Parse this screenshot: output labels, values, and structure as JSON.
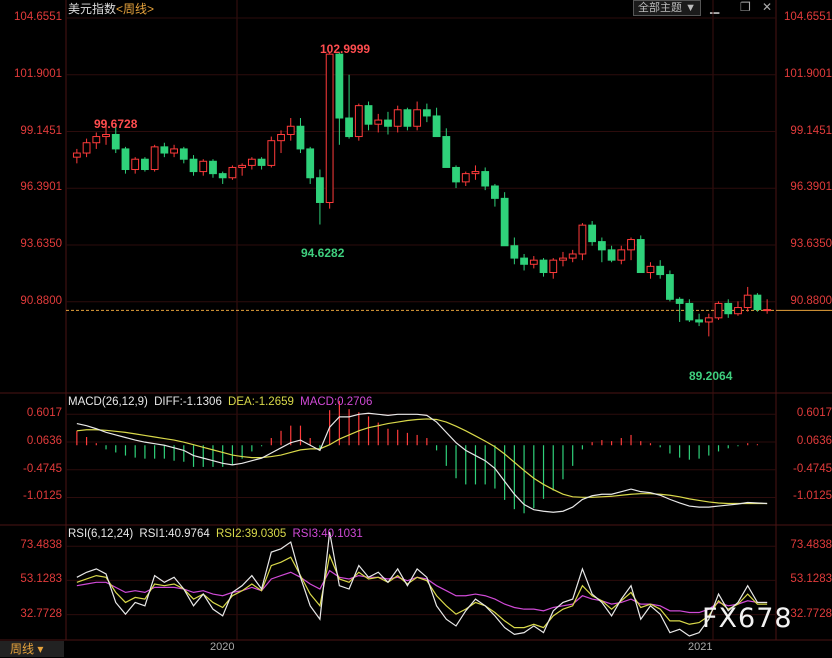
{
  "header": {
    "title": "美元指数",
    "period_label": "<周线>",
    "theme_button": "全部主题",
    "icons": [
      "down-arrow-icon",
      "maximize-icon",
      "restore-icon",
      "close-icon"
    ]
  },
  "colors": {
    "up": "#ff3b3b",
    "down": "#2fd17a",
    "diff": "#e8e8e8",
    "dea": "#d9d94a",
    "macd": "#d04ad6",
    "grid": "#3a1010",
    "last": "#e7a33c"
  },
  "main_axis_ticks": [
    "104.6551",
    "101.9001",
    "99.1451",
    "96.3901",
    "93.6350",
    "90.8800"
  ],
  "main_axis_values": [
    104.6551,
    101.9001,
    99.1451,
    96.3901,
    93.635,
    90.88
  ],
  "annotations": {
    "high": "102.9999",
    "prev_high": "99.6728",
    "low1": "94.6282",
    "low2": "89.2064"
  },
  "macd": {
    "label": "MACD(26,12,9)",
    "diff_label": "DIFF:-1.1306",
    "dea_label": "DEA:-1.2659",
    "macd_label": "MACD:0.2706",
    "ticks": [
      "0.6017",
      "0.0636",
      "-0.4745",
      "-1.0125"
    ],
    "tick_values": [
      0.6017,
      0.0636,
      -0.4745,
      -1.0125
    ]
  },
  "rsi": {
    "label": "RSI(6,12,24)",
    "rsi1_label": "RSI1:40.9764",
    "rsi2_label": "RSI2:39.0305",
    "rsi3_label": "RSI3:40.1031",
    "ticks": [
      "73.4838",
      "53.1283",
      "32.7728"
    ],
    "tick_values": [
      73.4838,
      53.1283,
      32.7728
    ]
  },
  "x_labels": [
    "2020",
    "2021"
  ],
  "footer": {
    "period_button": "周线",
    "watermark": "FX678"
  },
  "chart_data": {
    "type": "candlestick",
    "title": "美元指数 <周线>",
    "ylim": [
      86.5,
      104.6551
    ],
    "last_close": 90.46,
    "candles": [
      [
        97.9,
        98.3,
        97.6,
        98.1
      ],
      [
        98.1,
        98.8,
        97.9,
        98.6
      ],
      [
        98.6,
        99.1,
        98.3,
        98.9
      ],
      [
        98.9,
        99.67,
        98.5,
        99.0
      ],
      [
        99.0,
        99.4,
        98.1,
        98.3
      ],
      [
        98.3,
        98.4,
        97.1,
        97.3
      ],
      [
        97.3,
        97.9,
        97.1,
        97.8
      ],
      [
        97.8,
        97.9,
        97.2,
        97.3
      ],
      [
        97.3,
        98.5,
        97.2,
        98.4
      ],
      [
        98.4,
        98.6,
        97.9,
        98.1
      ],
      [
        98.1,
        98.5,
        97.9,
        98.3
      ],
      [
        98.3,
        98.4,
        97.6,
        97.8
      ],
      [
        97.8,
        98.0,
        97.0,
        97.2
      ],
      [
        97.2,
        97.8,
        97.0,
        97.7
      ],
      [
        97.7,
        97.8,
        96.9,
        97.1
      ],
      [
        97.1,
        97.2,
        96.6,
        96.9
      ],
      [
        96.9,
        97.5,
        96.8,
        97.4
      ],
      [
        97.4,
        97.6,
        97.0,
        97.5
      ],
      [
        97.5,
        97.9,
        97.3,
        97.8
      ],
      [
        97.8,
        97.9,
        97.3,
        97.5
      ],
      [
        97.5,
        98.9,
        97.4,
        98.7
      ],
      [
        98.7,
        99.2,
        98.1,
        99.0
      ],
      [
        99.0,
        99.8,
        98.7,
        99.4
      ],
      [
        99.4,
        99.8,
        98.1,
        98.3
      ],
      [
        98.3,
        98.4,
        96.6,
        96.9
      ],
      [
        96.9,
        97.3,
        94.63,
        95.7
      ],
      [
        95.7,
        102.99,
        95.4,
        102.9
      ],
      [
        102.9,
        102.99,
        98.5,
        99.8
      ],
      [
        99.8,
        101.9,
        98.8,
        98.9
      ],
      [
        98.9,
        100.5,
        98.7,
        100.4
      ],
      [
        100.4,
        100.6,
        99.2,
        99.5
      ],
      [
        99.5,
        100.0,
        99.1,
        99.7
      ],
      [
        99.7,
        100.1,
        99.0,
        99.4
      ],
      [
        99.4,
        100.4,
        99.1,
        100.2
      ],
      [
        100.2,
        100.3,
        99.2,
        99.4
      ],
      [
        99.4,
        100.6,
        99.2,
        100.2
      ],
      [
        100.2,
        100.5,
        99.6,
        99.9
      ],
      [
        99.9,
        100.3,
        98.9,
        98.9
      ],
      [
        98.9,
        99.3,
        97.4,
        97.4
      ],
      [
        97.4,
        97.5,
        96.4,
        96.7
      ],
      [
        96.7,
        97.2,
        96.5,
        97.1
      ],
      [
        97.1,
        97.5,
        96.8,
        97.2
      ],
      [
        97.2,
        97.4,
        96.3,
        96.5
      ],
      [
        96.5,
        96.6,
        95.5,
        95.9
      ],
      [
        95.9,
        96.2,
        93.6,
        93.6
      ],
      [
        93.6,
        94.0,
        92.7,
        93.0
      ],
      [
        93.0,
        93.2,
        92.4,
        92.7
      ],
      [
        92.7,
        93.1,
        92.5,
        92.9
      ],
      [
        92.9,
        93.0,
        92.1,
        92.3
      ],
      [
        92.3,
        93.0,
        92.0,
        92.9
      ],
      [
        92.9,
        93.3,
        92.6,
        93.0
      ],
      [
        93.0,
        93.4,
        92.8,
        93.2
      ],
      [
        93.2,
        94.7,
        92.9,
        94.6
      ],
      [
        94.6,
        94.8,
        93.6,
        93.8
      ],
      [
        93.8,
        94.0,
        92.8,
        93.4
      ],
      [
        93.4,
        93.6,
        92.8,
        92.9
      ],
      [
        92.9,
        93.6,
        92.7,
        93.4
      ],
      [
        93.4,
        94.0,
        92.9,
        93.9
      ],
      [
        93.9,
        94.1,
        92.3,
        92.3
      ],
      [
        92.3,
        92.8,
        92.0,
        92.6
      ],
      [
        92.6,
        92.9,
        92.0,
        92.2
      ],
      [
        92.2,
        92.4,
        90.9,
        91.0
      ],
      [
        91.0,
        91.1,
        89.9,
        90.8
      ],
      [
        90.8,
        91.0,
        89.9,
        90.0
      ],
      [
        90.0,
        90.3,
        89.7,
        89.9
      ],
      [
        89.9,
        90.3,
        89.2,
        90.1
      ],
      [
        90.1,
        90.9,
        90.0,
        90.8
      ],
      [
        90.8,
        91.0,
        90.1,
        90.3
      ],
      [
        90.3,
        90.9,
        90.2,
        90.6
      ],
      [
        90.6,
        91.6,
        90.4,
        91.2
      ],
      [
        91.2,
        91.3,
        90.4,
        90.5
      ],
      [
        90.5,
        91.0,
        90.3,
        90.5
      ]
    ],
    "macd_ylim": [
      -1.45,
      0.8
    ],
    "diff": [
      0.42,
      0.38,
      0.32,
      0.25,
      0.2,
      0.15,
      0.1,
      0.06,
      0.03,
      0.0,
      -0.05,
      -0.1,
      -0.2,
      -0.25,
      -0.3,
      -0.35,
      -0.38,
      -0.35,
      -0.3,
      -0.25,
      -0.15,
      -0.05,
      0.05,
      0.1,
      0.0,
      -0.1,
      0.35,
      0.55,
      0.55,
      0.6,
      0.62,
      0.6,
      0.58,
      0.6,
      0.6,
      0.6,
      0.58,
      0.45,
      0.25,
      0.05,
      -0.1,
      -0.2,
      -0.3,
      -0.45,
      -0.7,
      -0.95,
      -1.15,
      -1.25,
      -1.28,
      -1.3,
      -1.28,
      -1.2,
      -1.05,
      -0.98,
      -0.95,
      -0.95,
      -0.9,
      -0.85,
      -0.9,
      -0.92,
      -0.97,
      -1.05,
      -1.12,
      -1.18,
      -1.2,
      -1.2,
      -1.18,
      -1.16,
      -1.14,
      -1.11,
      -1.12,
      -1.13
    ],
    "dea": [
      0.28,
      0.3,
      0.3,
      0.29,
      0.27,
      0.25,
      0.22,
      0.19,
      0.16,
      0.13,
      0.1,
      0.06,
      0.01,
      -0.04,
      -0.09,
      -0.14,
      -0.19,
      -0.22,
      -0.24,
      -0.24,
      -0.22,
      -0.19,
      -0.14,
      -0.09,
      -0.07,
      -0.07,
      0.01,
      0.12,
      0.2,
      0.28,
      0.34,
      0.38,
      0.42,
      0.45,
      0.48,
      0.5,
      0.51,
      0.5,
      0.45,
      0.37,
      0.28,
      0.18,
      0.08,
      -0.03,
      -0.17,
      -0.33,
      -0.49,
      -0.64,
      -0.76,
      -0.86,
      -0.95,
      -1.0,
      -1.01,
      -1.01,
      -1.0,
      -0.99,
      -0.97,
      -0.95,
      -0.94,
      -0.94,
      -0.95,
      -0.97,
      -1.0,
      -1.04,
      -1.07,
      -1.1,
      -1.12,
      -1.13,
      -1.13,
      -1.13,
      -1.13,
      -1.13
    ],
    "rsi_ylim": [
      20,
      82
    ],
    "rsi1": [
      55,
      58,
      60,
      57,
      40,
      33,
      40,
      38,
      56,
      52,
      55,
      48,
      38,
      45,
      36,
      32,
      46,
      50,
      56,
      48,
      70,
      72,
      76,
      55,
      38,
      30,
      82,
      50,
      48,
      62,
      55,
      58,
      52,
      60,
      50,
      60,
      55,
      38,
      30,
      26,
      35,
      42,
      38,
      32,
      25,
      21,
      22,
      26,
      22,
      35,
      40,
      42,
      60,
      45,
      40,
      32,
      42,
      50,
      30,
      38,
      33,
      22,
      24,
      20,
      22,
      30,
      45,
      35,
      40,
      50,
      40,
      40
    ],
    "rsi2": [
      52,
      54,
      56,
      55,
      46,
      40,
      43,
      42,
      51,
      50,
      51,
      48,
      42,
      45,
      40,
      37,
      44,
      47,
      51,
      47,
      62,
      64,
      67,
      56,
      45,
      38,
      68,
      54,
      52,
      58,
      54,
      55,
      52,
      56,
      51,
      55,
      53,
      44,
      38,
      33,
      36,
      40,
      38,
      34,
      29,
      25,
      25,
      27,
      25,
      32,
      36,
      38,
      50,
      44,
      41,
      36,
      41,
      46,
      37,
      39,
      36,
      29,
      29,
      27,
      28,
      32,
      41,
      36,
      39,
      45,
      39,
      39
    ],
    "rsi3": [
      50,
      51,
      52,
      52,
      49,
      46,
      47,
      46,
      49,
      49,
      49,
      48,
      46,
      47,
      45,
      44,
      46,
      47,
      49,
      47,
      54,
      56,
      58,
      55,
      51,
      48,
      59,
      55,
      54,
      56,
      55,
      55,
      54,
      55,
      53,
      55,
      54,
      50,
      47,
      44,
      44,
      45,
      44,
      42,
      39,
      37,
      36,
      36,
      35,
      37,
      38,
      39,
      44,
      42,
      41,
      39,
      40,
      42,
      39,
      39,
      38,
      35,
      35,
      34,
      34,
      36,
      40,
      38,
      39,
      41,
      40,
      40
    ]
  }
}
